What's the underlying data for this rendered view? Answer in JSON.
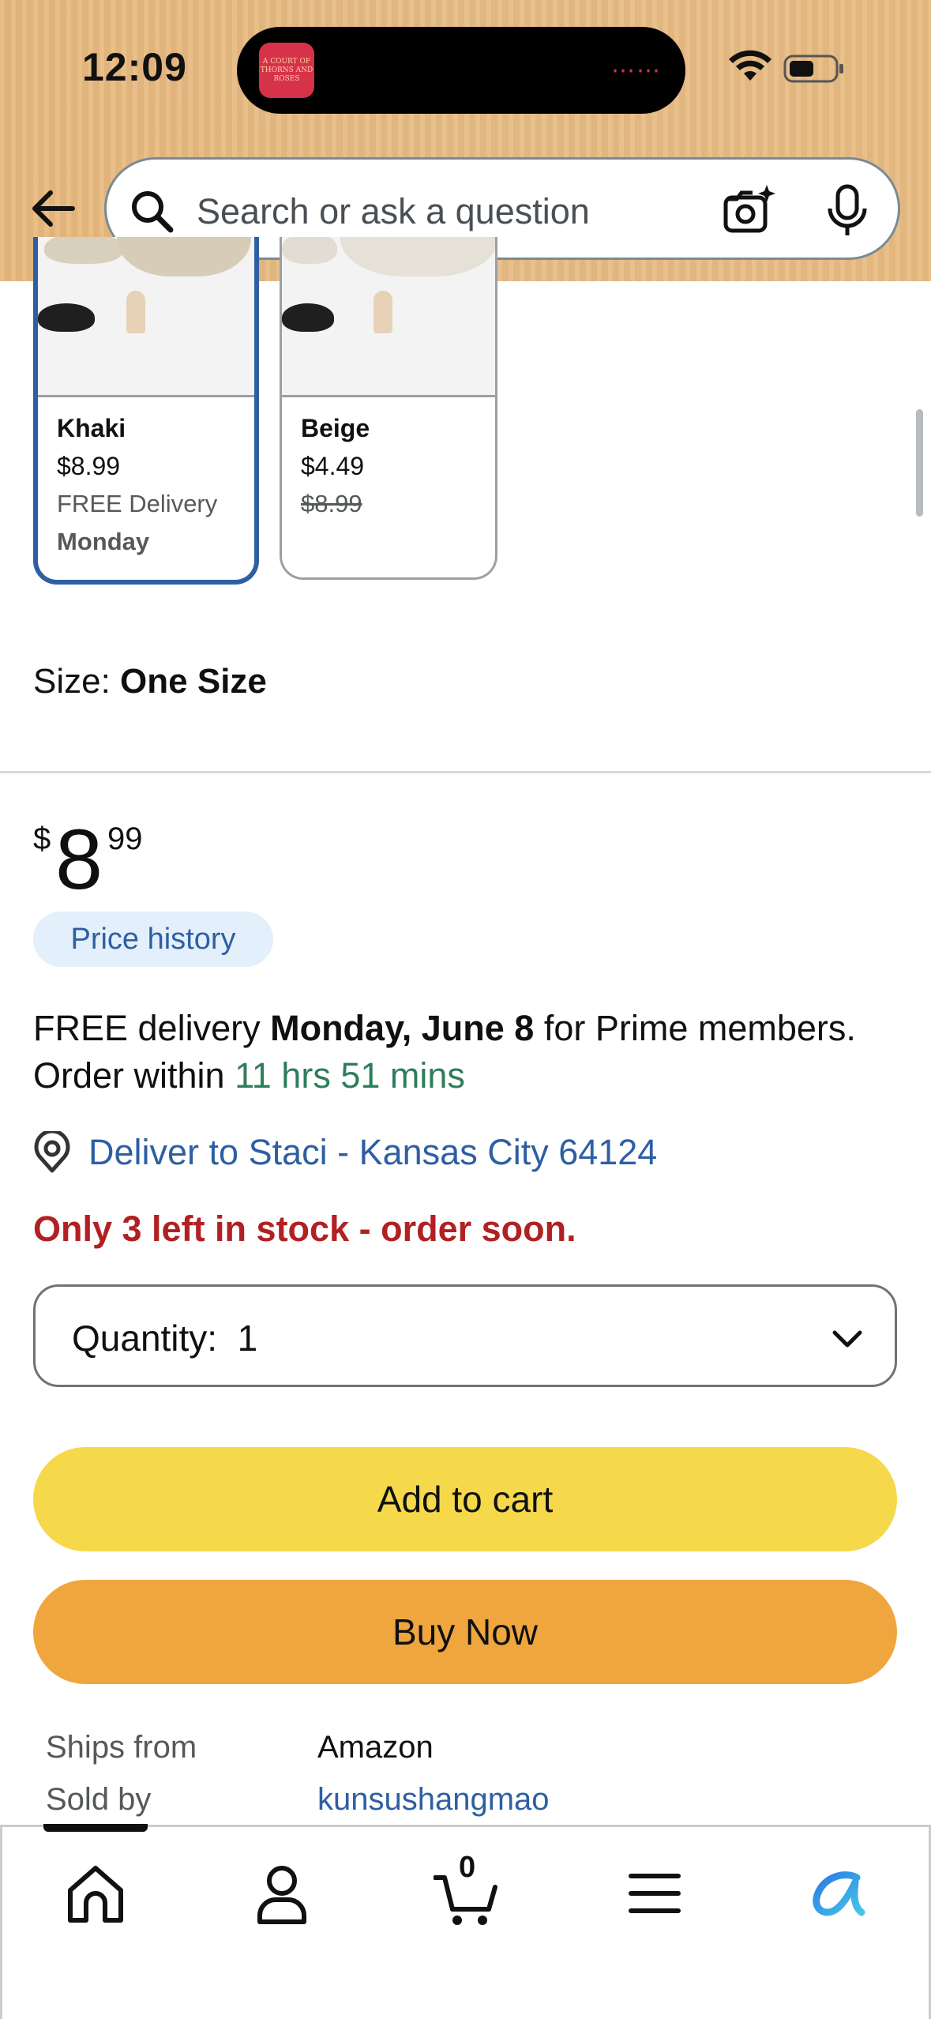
{
  "status_bar": {
    "time": "12:09",
    "now_playing_art_text": "A COURT OF THORNS AND ROSES"
  },
  "search": {
    "placeholder": "Search or ask a question"
  },
  "variants": [
    {
      "name": "Khaki",
      "price": "$8.99",
      "line3": "FREE Delivery",
      "line4": "Monday",
      "selected": true
    },
    {
      "name": "Beige",
      "price": "$4.49",
      "list_price": "$8.99",
      "selected": false
    }
  ],
  "size": {
    "label": "Size: ",
    "value": "One Size"
  },
  "price": {
    "symbol": "$",
    "whole": "8",
    "fraction": "99"
  },
  "price_history_label": "Price history",
  "delivery": {
    "prefix": "FREE delivery ",
    "date": "Monday, June 8",
    "middle": " for Prime members. Order within ",
    "countdown": "11 hrs 51 mins"
  },
  "deliver_to": "Deliver to Staci - Kansas City 64124",
  "stock_message": "Only 3 left in stock - order soon.",
  "quantity": {
    "label": "Quantity:",
    "value": "1"
  },
  "buttons": {
    "add_to_cart": "Add to cart",
    "buy_now": "Buy Now"
  },
  "shipping": {
    "ships_from_label": "Ships from",
    "ships_from_value": "Amazon",
    "sold_by_label": "Sold by",
    "sold_by_value": "kunsushangmao"
  },
  "bottom_nav": {
    "cart_count": "0",
    "items": [
      "home-icon",
      "profile-icon",
      "cart-icon",
      "menu-icon",
      "rufus-icon"
    ]
  },
  "colors": {
    "header_bg": "#e8b97f",
    "link_blue": "#2e5fa3",
    "countdown_green": "#2e7d5b",
    "stock_red": "#b12023",
    "add_to_cart_yellow": "#f6d84b",
    "buy_now_orange": "#efa63f"
  }
}
